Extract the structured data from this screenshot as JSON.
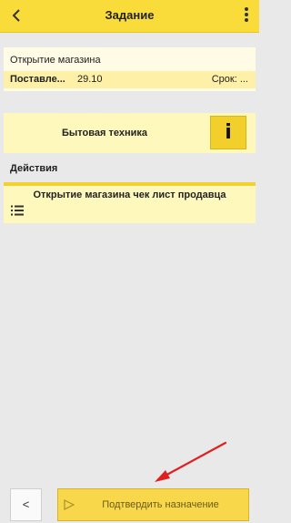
{
  "header": {
    "title": "Задание",
    "back_icon": "chevron-left-icon",
    "menu_icon": "more-vertical-icon"
  },
  "task": {
    "title": "Открытие магазина",
    "supplier_label": "Поставле...",
    "date": "29.10",
    "deadline_label": "Срок: ..."
  },
  "category": {
    "label": "Бытовая техника",
    "info_glyph": "i"
  },
  "actions_section": {
    "title": "Действия"
  },
  "action_item": {
    "title": "Открытие магазина чек лист продавца",
    "icon": "list-icon"
  },
  "footer": {
    "back_label": "<",
    "confirm_label": "Подтвердить назначение",
    "confirm_icon": "play-outline-icon"
  },
  "colors": {
    "accent": "#f9dc3a",
    "card_light": "#fff8bc",
    "background": "#e9e9e9",
    "annotation": "#e02020"
  }
}
